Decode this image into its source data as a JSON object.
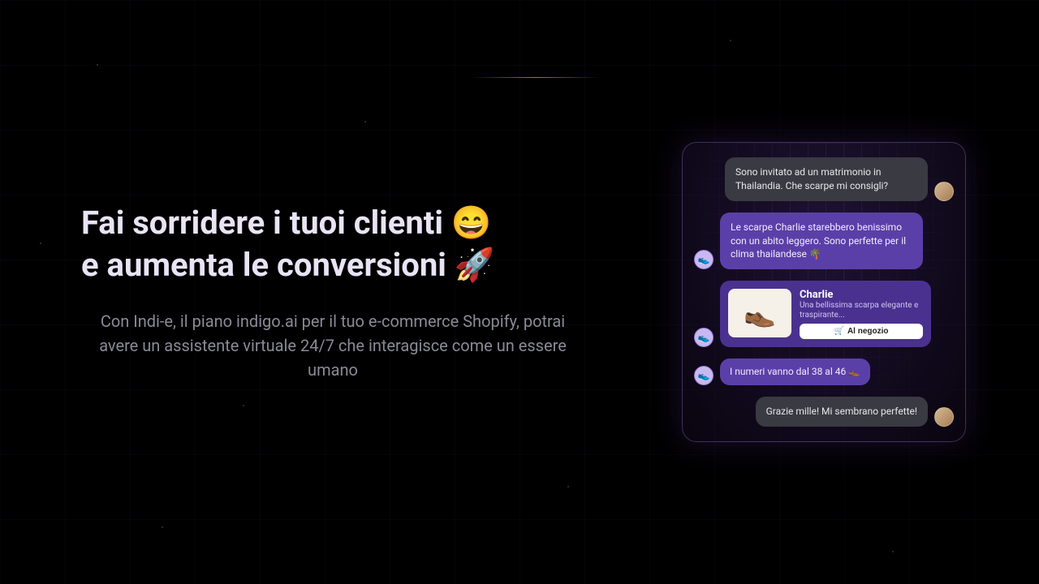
{
  "hero": {
    "headline_line1": "Fai sorridere i tuoi clienti 😄",
    "headline_line2": "e aumenta le conversioni 🚀",
    "subtext": "Con Indi-e, il piano indigo.ai per il tuo e-commerce Shopify, potrai avere un assistente virtuale 24/7 che interagisce come un essere umano"
  },
  "chat": {
    "messages": [
      {
        "role": "user",
        "text": "Sono invitato ad un matrimonio in Thailandia. Che scarpe mi consigli?"
      },
      {
        "role": "bot",
        "text": "Le scarpe Charlie starebbero benissimo con un abito leggero. Sono perfette per il clima thailandese 🌴"
      },
      {
        "role": "product",
        "title": "Charlie",
        "desc": "Una bellissima scarpa elegante e traspirante...",
        "button": "Al negozio"
      },
      {
        "role": "bot",
        "text": "I numeri vanno dal 38 al 46 👞"
      },
      {
        "role": "user",
        "text": "Grazie mille! Mi sembrano perfette!"
      }
    ],
    "bot_icon": "👟",
    "product_icon": "👞",
    "cart_icon": "🛒"
  }
}
